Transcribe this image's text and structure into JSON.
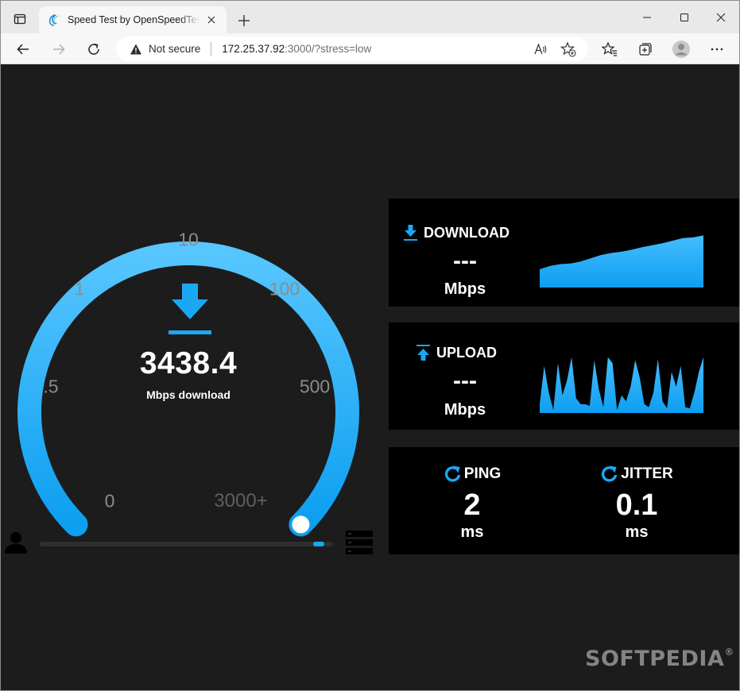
{
  "browser": {
    "tab_title": "Speed Test by OpenSpeedTest.com",
    "security_text": "Not secure",
    "url_host": "172.25.37.92",
    "url_rest": ":3000/?stress=low",
    "icons": {
      "tab_actions": "tab-actions-icon",
      "close_tab": "close-icon",
      "new_tab": "plus-icon",
      "minimize": "minimize-icon",
      "maximize": "maximize-icon",
      "close_window": "close-icon",
      "back": "arrow-left-icon",
      "forward": "arrow-right-icon",
      "refresh": "refresh-icon",
      "read_aloud": "read-aloud-icon",
      "add_favorite": "star-plus-icon",
      "favorites": "favorites-icon",
      "collections": "collections-icon",
      "profile": "profile-icon",
      "menu": "more-icon"
    }
  },
  "gauge": {
    "accent_color": "#1aa8f5",
    "scale_labels": [
      {
        "text": "0",
        "key": "l0"
      },
      {
        "text": ".5",
        "key": "l1"
      },
      {
        "text": "1",
        "key": "l2"
      },
      {
        "text": "10",
        "key": "l3"
      },
      {
        "text": "100",
        "key": "l4"
      },
      {
        "text": "500",
        "key": "l5"
      },
      {
        "text": "3000+",
        "key": "l6"
      }
    ],
    "current_value": "3438.4",
    "unit_label": "Mbps download",
    "fill_fraction": 1.0,
    "stress_progress": 0.97
  },
  "download": {
    "title": "DOWNLOAD",
    "value": "---",
    "unit": "Mbps",
    "trend": [
      0.28,
      0.33,
      0.36,
      0.37,
      0.4,
      0.45,
      0.5,
      0.53,
      0.55,
      0.58,
      0.62,
      0.65,
      0.68,
      0.72,
      0.76,
      0.77,
      0.8
    ]
  },
  "upload": {
    "title": "UPLOAD",
    "value": "---",
    "unit": "Mbps",
    "trend": [
      0.15,
      0.8,
      0.35,
      0.05,
      0.85,
      0.3,
      0.55,
      0.95,
      0.25,
      0.15,
      0.15,
      0.12,
      0.9,
      0.4,
      0.1,
      0.95,
      0.85,
      0.05,
      0.3,
      0.2,
      0.45,
      0.9,
      0.6,
      0.15,
      0.1,
      0.35,
      0.92,
      0.2,
      0.08,
      0.7,
      0.45,
      0.8,
      0.1,
      0.08,
      0.35,
      0.7,
      0.95
    ]
  },
  "ping": {
    "title": "PING",
    "value": "2",
    "unit": "ms"
  },
  "jitter": {
    "title": "JITTER",
    "value": "0.1",
    "unit": "ms"
  },
  "watermark": {
    "text": "SOFTPEDIA",
    "mark": "®"
  }
}
